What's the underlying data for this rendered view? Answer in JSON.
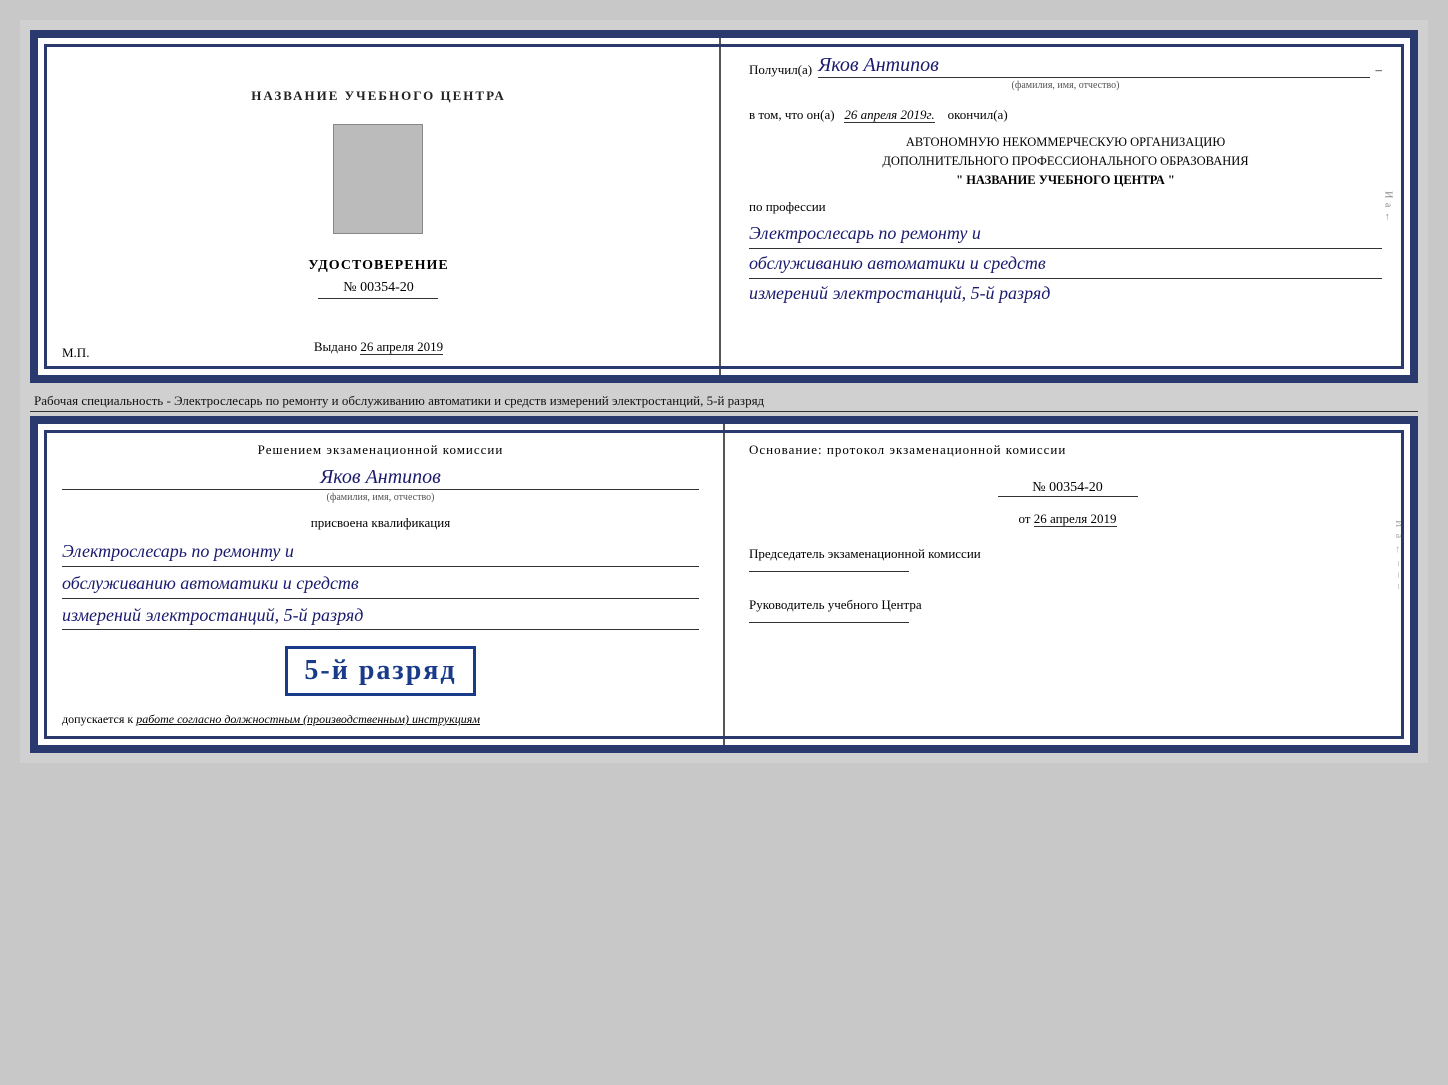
{
  "top": {
    "left": {
      "center_title": "НАЗВАНИЕ УЧЕБНОГО ЦЕНТРА",
      "cert_title": "УДОСТОВЕРЕНИЕ",
      "cert_number": "№ 00354-20",
      "issued_label": "Выдано",
      "issued_date": "26 апреля 2019",
      "mp_label": "М.П."
    },
    "right": {
      "received_label": "Получил(а)",
      "recipient_name": "Яков Антипов",
      "name_sub": "(фамилия, имя, отчество)",
      "in_that_label": "в том, что он(а)",
      "completion_date": "26 апреля 2019г.",
      "finished_label": "окончил(а)",
      "org_line1": "АВТОНОМНУЮ НЕКОММЕРЧЕСКУЮ ОРГАНИЗАЦИЮ",
      "org_line2": "ДОПОЛНИТЕЛЬНОГО ПРОФЕССИОНАЛЬНОГО ОБРАЗОВАНИЯ",
      "org_name": "\" НАЗВАНИЕ УЧЕБНОГО ЦЕНТРА \"",
      "profession_label": "по профессии",
      "profession_line1": "Электрослесарь по ремонту и",
      "profession_line2": "обслуживанию автоматики и средств",
      "profession_line3": "измерений электростанций, 5-й разряд"
    }
  },
  "separator": {
    "text": "Рабочая специальность - Электрослесарь по ремонту и обслуживанию автоматики и средств измерений электростанций, 5-й разряд"
  },
  "bottom": {
    "left": {
      "decision_title": "Решением экзаменационной комиссии",
      "person_name": "Яков Антипов",
      "name_sub": "(фамилия, имя, отчество)",
      "assigned_label": "присвоена квалификация",
      "qual_line1": "Электрослесарь по ремонту и",
      "qual_line2": "обслуживанию автоматики и средств",
      "qual_line3": "измерений электростанций, 5-й разряд",
      "rank_badge": "5-й разряд",
      "allowed_prefix": "допускается к",
      "allowed_italic": "работе согласно должностным (производственным) инструкциям"
    },
    "right": {
      "basis_label": "Основание: протокол экзаменационной комиссии",
      "protocol_number": "№ 00354-20",
      "from_label": "от",
      "protocol_date": "26 апреля 2019",
      "chairman_title": "Председатель экзаменационной комиссии",
      "director_title": "Руководитель учебного Центра"
    }
  }
}
